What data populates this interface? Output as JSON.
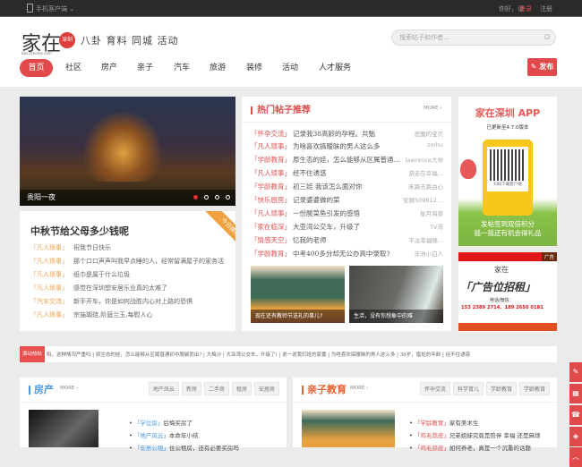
{
  "topbar": {
    "mobile_client": "手机客户端 ⌄",
    "greeting": "你好，请",
    "login": "登录",
    "register": "注册"
  },
  "header": {
    "logo": "家在",
    "logo_badge": "深圳",
    "logo_domain": "bbs.szhome.com",
    "slogan": "八卦 育料 同城 活动",
    "search_placeholder": "搜索帖子和作者...",
    "publish": "发布"
  },
  "nav": [
    "首页",
    "社区",
    "房产",
    "亲子",
    "汽车",
    "旅游",
    "装修",
    "活动",
    "人才服务"
  ],
  "carousel": {
    "caption": "贵阳一夜",
    "dots": 4,
    "active": 0
  },
  "hot": {
    "title": "热门帖子推荐",
    "more": "MORE ›",
    "items": [
      {
        "tag": "「怀孕交流」",
        "title": "记录我38高龄的孕程。共勉",
        "author": "恶魔的宝贝"
      },
      {
        "tag": "「凡人琐事」",
        "title": "为啥喜欢搞暧昧的男人这么多",
        "author": "zmhu"
      },
      {
        "tag": "「学龄教育」",
        "title": "原生态的娃，怎么能够从区属普通初中...",
        "author": "lawrence大帅"
      },
      {
        "tag": "「凡人琐事」",
        "title": "经不住诱惑",
        "author": "游走在幸福..."
      },
      {
        "tag": "「学龄教育」",
        "title": "初三娃 我该怎么面对你",
        "author": "来路去路由心"
      },
      {
        "tag": "「快乐厨房」",
        "title": "记录婆婆做的菜",
        "author": "安娜5098121..."
      },
      {
        "tag": "「凡人琐事」",
        "title": "一份酸菜鱼引发的感悟",
        "author": "星月海棠"
      },
      {
        "tag": "「家在临深」",
        "title": "大亚湾公交车，升级了",
        "author": "TV哥"
      },
      {
        "tag": "「情感天空」",
        "title": "忆我的老师",
        "author": "平淡幸福随..."
      },
      {
        "tag": "「学龄教育」",
        "title": "中考400多分却无公办高中录取?",
        "author": "非洲小白人"
      }
    ],
    "images": [
      {
        "caption": "现在还有教师节送礼的事儿?"
      },
      {
        "caption": "生活，没有你想象中的难"
      }
    ]
  },
  "today": {
    "ribbon": "今日推荐",
    "title": "中秋节给父母多少钱呢",
    "items": [
      {
        "tag": "「凡人琐事」",
        "title": "祝我节日快乐"
      },
      {
        "tag": "「凡人琐事」",
        "title": "那个口口声声叫我早点睡的人，经常留满屋子的家务活"
      },
      {
        "tag": "「凡人琐事」",
        "title": "纸巾是属于什么垃圾"
      },
      {
        "tag": "「凡人琐事」",
        "title": "感觉在深圳想安居乐业真的太难了"
      },
      {
        "tag": "「汽车交流」",
        "title": "新手开车，你是如何战胜内心对上路的恐惧"
      },
      {
        "tag": "「凡人琐事」",
        "title": "宗庙瑚琏,阶庭兰玉,每慰人心"
      }
    ]
  },
  "app_ad": {
    "title": "家在深圳 APP",
    "version": "已更新至4.7.0版本",
    "scan": "扫码下载客户端",
    "line1": "发帖签到双倍积分",
    "line2": "摇一摇还有机会得礼品"
  },
  "rent_ad": {
    "label": "广告",
    "headline": "「广告位招租」",
    "contact": "电话/微信：",
    "phones": "153 2389 2714、189 2650 0181"
  },
  "ticker": {
    "label": "滚动热帖",
    "text": "阳。这种情况严重吗 | 原生态的娃，怎么能够从区属普通初中脱颖而出? | 大梅沙 | 大亚湾公交车，升级了! | 说一说我们班的家委 | 为啥喜欢搞暧昧的男人这么多 | 36岁，尴尬的年龄 | 经不住诱惑"
  },
  "house": {
    "title": "房产",
    "more": "MORE ›",
    "tabs": [
      "地产风云",
      "新房",
      "二手房",
      "租房",
      "安居房"
    ],
    "items": [
      {
        "tag": "「学位房」",
        "title": "后悔买房了"
      },
      {
        "tag": "「地产风云」",
        "title": "本命年小结"
      },
      {
        "tag": "「安居公租」",
        "title": "住公租房，还有必要买房吗"
      }
    ]
  },
  "kids": {
    "title": "亲子教育",
    "more": "MORE ›",
    "tabs": [
      "怀孕交流",
      "科学育儿",
      "学龄教育",
      "学龄教育"
    ],
    "items": [
      {
        "tag": "「学龄教育」",
        "title": "家有美术生"
      },
      {
        "tag": "「鸡毛蒜皮」",
        "title": "兄弟姐妹究竟是陪伴 幸福 还是麻烦"
      },
      {
        "tag": "「鸡毛蒜皮」",
        "title": "如何养老，真是一个沉重的话题"
      }
    ]
  },
  "colors": {
    "accent": "#e04a4a",
    "blue": "#4a9ae0",
    "orange": "#f0a050"
  }
}
